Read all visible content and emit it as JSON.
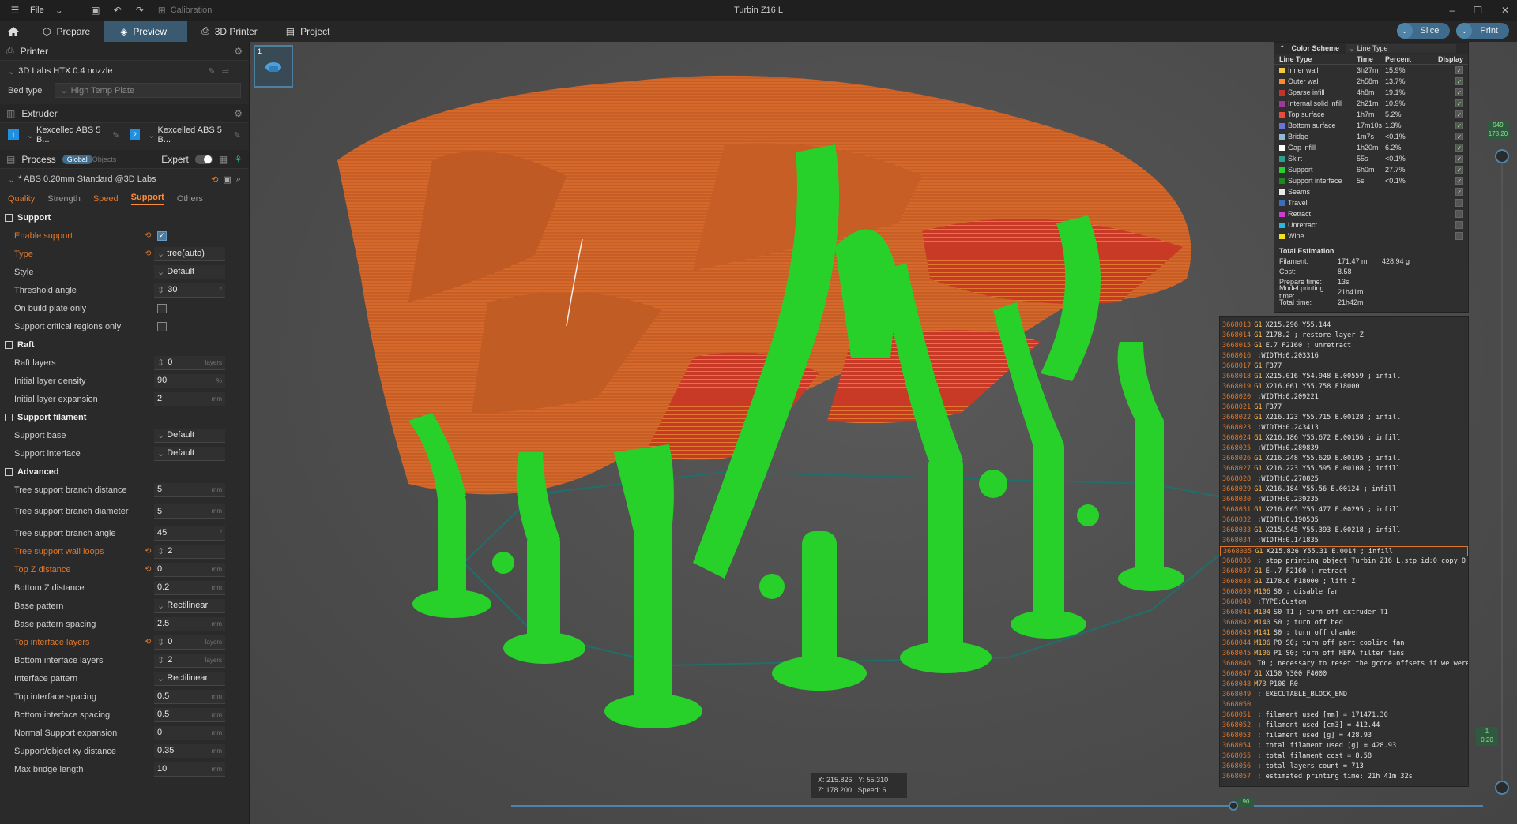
{
  "titlebar": {
    "file_label": "File",
    "calibration_label": "Calibration",
    "window_title": "Turbin Z16 L"
  },
  "tabs": [
    {
      "label": "Prepare"
    },
    {
      "label": "Preview"
    },
    {
      "label": "3D Printer"
    },
    {
      "label": "Project"
    }
  ],
  "actions": {
    "slice": "Slice",
    "print": "Print"
  },
  "printer": {
    "section": "Printer",
    "preset": "3D Labs HTX 0.4 nozzle",
    "bed_type_label": "Bed type",
    "bed_type": "High Temp Plate"
  },
  "extruder": {
    "section": "Extruder",
    "e1_index": "1",
    "e1": "Kexcelled ABS 5 B...",
    "e2_index": "2",
    "e2": "Kexcelled ABS 5 B..."
  },
  "process": {
    "section": "Process",
    "global": "Global",
    "objects": "Objects",
    "expert": "Expert",
    "preset": "* ABS 0.20mm Standard @3D Labs"
  },
  "setting_tabs": [
    "Quality",
    "Strength",
    "Speed",
    "Support",
    "Others"
  ],
  "groups": {
    "support": "Support",
    "raft": "Raft",
    "support_filament": "Support filament",
    "advanced": "Advanced"
  },
  "support_settings": [
    {
      "name": "Enable support",
      "value": "",
      "unit": ""
    },
    {
      "name": "Type",
      "value": "tree(auto)",
      "unit": ""
    },
    {
      "name": "Style",
      "value": "Default",
      "unit": ""
    },
    {
      "name": "Threshold angle",
      "value": "30",
      "unit": "°"
    },
    {
      "name": "On build plate only",
      "value": "",
      "unit": ""
    },
    {
      "name": "Support critical regions only",
      "value": "",
      "unit": ""
    }
  ],
  "raft_settings": [
    {
      "name": "Raft layers",
      "value": "0",
      "unit": "layers"
    },
    {
      "name": "Initial layer density",
      "value": "90",
      "unit": "%"
    },
    {
      "name": "Initial layer expansion",
      "value": "2",
      "unit": "mm"
    }
  ],
  "filament_settings": [
    {
      "name": "Support base",
      "value": "Default"
    },
    {
      "name": "Support interface",
      "value": "Default"
    }
  ],
  "advanced_settings": [
    {
      "name": "Tree support branch distance",
      "value": "5",
      "unit": "mm"
    },
    {
      "name": "Tree support branch diameter",
      "value": "5",
      "unit": "mm"
    },
    {
      "name": "Tree support branch angle",
      "value": "45",
      "unit": "°"
    },
    {
      "name": "Tree support wall loops",
      "value": "2",
      "unit": ""
    },
    {
      "name": "Top Z distance",
      "value": "0",
      "unit": "mm"
    },
    {
      "name": "Bottom Z distance",
      "value": "0.2",
      "unit": "mm"
    },
    {
      "name": "Base pattern",
      "value": "Rectilinear",
      "unit": ""
    },
    {
      "name": "Base pattern spacing",
      "value": "2.5",
      "unit": "mm"
    },
    {
      "name": "Top interface layers",
      "value": "0",
      "unit": "layers"
    },
    {
      "name": "Bottom interface layers",
      "value": "2",
      "unit": "layers"
    },
    {
      "name": "Interface pattern",
      "value": "Rectilinear",
      "unit": ""
    },
    {
      "name": "Top interface spacing",
      "value": "0.5",
      "unit": "mm"
    },
    {
      "name": "Bottom interface spacing",
      "value": "0.5",
      "unit": "mm"
    },
    {
      "name": "Normal Support expansion",
      "value": "0",
      "unit": "mm"
    },
    {
      "name": "Support/object xy distance",
      "value": "0.35",
      "unit": "mm"
    },
    {
      "name": "Max bridge length",
      "value": "10",
      "unit": "mm"
    }
  ],
  "legend": {
    "title": "Color Scheme",
    "scheme": "Line Type",
    "headers": [
      "Line Type",
      "Time",
      "Percent",
      "Display"
    ],
    "rows": [
      {
        "name": "Inner wall",
        "time": "3h27m",
        "pct": "15.9%",
        "color": "#f5c842",
        "on": true
      },
      {
        "name": "Outer wall",
        "time": "2h58m",
        "pct": "13.7%",
        "color": "#ff8a2a",
        "on": true
      },
      {
        "name": "Sparse infill",
        "time": "4h8m",
        "pct": "19.1%",
        "color": "#c8322d",
        "on": true
      },
      {
        "name": "Internal solid infill",
        "time": "2h21m",
        "pct": "10.9%",
        "color": "#a0389a",
        "on": true
      },
      {
        "name": "Top surface",
        "time": "1h7m",
        "pct": "5.2%",
        "color": "#e84b3c",
        "on": true
      },
      {
        "name": "Bottom surface",
        "time": "17m10s",
        "pct": "1.3%",
        "color": "#6a74d6",
        "on": true
      },
      {
        "name": "Bridge",
        "time": "1m7s",
        "pct": "<0.1%",
        "color": "#8fb8d8",
        "on": true
      },
      {
        "name": "Gap infill",
        "time": "1h20m",
        "pct": "6.2%",
        "color": "#ffffff",
        "on": true
      },
      {
        "name": "Skirt",
        "time": "55s",
        "pct": "<0.1%",
        "color": "#2aa08f",
        "on": true
      },
      {
        "name": "Support",
        "time": "6h0m",
        "pct": "27.7%",
        "color": "#28d12a",
        "on": true
      },
      {
        "name": "Support interface",
        "time": "5s",
        "pct": "<0.1%",
        "color": "#1a8a1a",
        "on": true
      },
      {
        "name": "Seams",
        "time": "",
        "pct": "",
        "color": "#e8e8e8",
        "on": true
      },
      {
        "name": "Travel",
        "time": "",
        "pct": "",
        "color": "#3a6cc0",
        "on": false
      },
      {
        "name": "Retract",
        "time": "",
        "pct": "",
        "color": "#d23bd2",
        "on": false
      },
      {
        "name": "Unretract",
        "time": "",
        "pct": "",
        "color": "#27b7e0",
        "on": false
      },
      {
        "name": "Wipe",
        "time": "",
        "pct": "",
        "color": "#f0e020",
        "on": false
      }
    ],
    "total_label": "Total Estimation",
    "estimates": [
      {
        "k": "Filament:",
        "v": "171.47 m",
        "w": "428.94 g"
      },
      {
        "k": "Cost:",
        "v": "8.58",
        "w": ""
      },
      {
        "k": "Prepare time:",
        "v": "13s",
        "w": ""
      },
      {
        "k": "Model printing time:",
        "v": "21h41m",
        "w": ""
      },
      {
        "k": "Total time:",
        "v": "21h42m",
        "w": ""
      }
    ]
  },
  "gcode": [
    {
      "n": "3668013",
      "c": "G1",
      "t": "X215.296 Y55.144"
    },
    {
      "n": "3668014",
      "c": "G1",
      "t": "Z178.2 ; restore layer Z"
    },
    {
      "n": "3668015",
      "c": "G1",
      "t": "E.7 F2160 ; unretract"
    },
    {
      "n": "3668016",
      "c": "",
      "t": ";WIDTH:0.203316"
    },
    {
      "n": "3668017",
      "c": "G1",
      "t": "F377"
    },
    {
      "n": "3668018",
      "c": "G1",
      "t": "X215.016 Y54.948 E.00559 ; infill"
    },
    {
      "n": "3668019",
      "c": "G1",
      "t": "X216.061 Y55.758 F18000"
    },
    {
      "n": "3668020",
      "c": "",
      "t": ";WIDTH:0.209221"
    },
    {
      "n": "3668021",
      "c": "G1",
      "t": "F377"
    },
    {
      "n": "3668022",
      "c": "G1",
      "t": "X216.123 Y55.715 E.00128 ; infill"
    },
    {
      "n": "3668023",
      "c": "",
      "t": ";WIDTH:0.243413"
    },
    {
      "n": "3668024",
      "c": "G1",
      "t": "X216.186 Y55.672 E.00156 ; infill"
    },
    {
      "n": "3668025",
      "c": "",
      "t": ";WIDTH:0.289839"
    },
    {
      "n": "3668026",
      "c": "G1",
      "t": "X216.248 Y55.629 E.00195 ; infill"
    },
    {
      "n": "3668027",
      "c": "G1",
      "t": "X216.223 Y55.595 E.00108 ; infill"
    },
    {
      "n": "3668028",
      "c": "",
      "t": ";WIDTH:0.270825"
    },
    {
      "n": "3668029",
      "c": "G1",
      "t": "X216.184 Y55.56 E.00124 ; infill"
    },
    {
      "n": "3668030",
      "c": "",
      "t": ";WIDTH:0.239235"
    },
    {
      "n": "3668031",
      "c": "G1",
      "t": "X216.065 Y55.477 E.00295 ; infill"
    },
    {
      "n": "3668032",
      "c": "",
      "t": ";WIDTH:0.190535"
    },
    {
      "n": "3668033",
      "c": "G1",
      "t": "X215.945 Y55.393 E.00218 ; infill"
    },
    {
      "n": "3668034",
      "c": "",
      "t": ";WIDTH:0.141835"
    },
    {
      "n": "3668035",
      "c": "G1",
      "t": "X215.826 Y55.31 E.0014 ; infill"
    },
    {
      "n": "3668036",
      "c": "",
      "t": "; stop printing object Turbin Z16 L.stp id:0 copy 0"
    },
    {
      "n": "3668037",
      "c": "G1",
      "t": "E-.7 F2160 ; retract"
    },
    {
      "n": "3668038",
      "c": "G1",
      "t": "Z178.6 F18000 ; lift Z"
    },
    {
      "n": "3668039",
      "c": "M106",
      "t": "S0 ; disable fan"
    },
    {
      "n": "3668040",
      "c": "",
      "t": ";TYPE:Custom"
    },
    {
      "n": "3668041",
      "c": "M104",
      "t": "S0 T1 ; turn off extruder T1"
    },
    {
      "n": "3668042",
      "c": "M140",
      "t": "S0 ; turn off bed"
    },
    {
      "n": "3668043",
      "c": "M141",
      "t": "S0 ; turn off chamber"
    },
    {
      "n": "3668044",
      "c": "M106",
      "t": "P0 S0; turn off part cooling fan"
    },
    {
      "n": "3668045",
      "c": "M106",
      "t": "P1 S0; turn off HEPA filter fans"
    },
    {
      "n": "3668046",
      "c": "",
      "t": "T0 ; necessary to reset the gcode offsets if we were using T1"
    },
    {
      "n": "3668047",
      "c": "G1",
      "t": "X150 Y300 F4000"
    },
    {
      "n": "3668048",
      "c": "M73",
      "t": "P100 R0"
    },
    {
      "n": "3668049",
      "c": "",
      "t": "; EXECUTABLE_BLOCK_END"
    },
    {
      "n": "3668050",
      "c": "",
      "t": ""
    },
    {
      "n": "3668051",
      "c": "",
      "t": "; filament used [mm] = 171471.30"
    },
    {
      "n": "3668052",
      "c": "",
      "t": "; filament used [cm3] = 412.44"
    },
    {
      "n": "3668053",
      "c": "",
      "t": "; filament used [g] = 428.93"
    },
    {
      "n": "3668054",
      "c": "",
      "t": "; total filament used [g] = 428.93"
    },
    {
      "n": "3668055",
      "c": "",
      "t": "; total filament cost = 8.58"
    },
    {
      "n": "3668056",
      "c": "",
      "t": "; total layers count = 713"
    },
    {
      "n": "3668057",
      "c": "",
      "t": "; estimated printing time: 21h 41m 32s"
    }
  ],
  "coords": {
    "x_label": "X:",
    "x": "215.826",
    "y_label": "Y:",
    "y": "55.310",
    "z_label": "Z:",
    "z": "178.200",
    "speed_label": "Speed:",
    "speed": "6"
  },
  "slider": {
    "top_value": "949",
    "top_sub": "178.20",
    "bottom_value": "1",
    "bottom_sub": "0.20",
    "h_value": "90"
  },
  "colors": {
    "accent": "#3f6c8c",
    "orange": "#e0762b",
    "support_green": "#28d12a",
    "model_orange": "#d9652a"
  }
}
